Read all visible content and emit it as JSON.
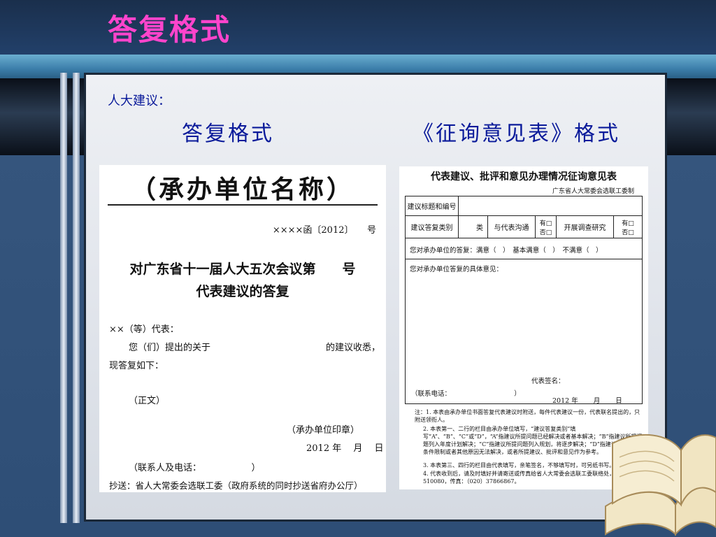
{
  "slide": {
    "title": "答复格式",
    "label": "人大建议：",
    "heading_left": "答复格式",
    "heading_right": "《征询意见表》格式"
  },
  "reply_doc": {
    "org_title": "（承办单位名称）",
    "ref_no": "××××函〔2012〕　　号",
    "heading_line1": "对广东省十一届人大五次会议第　　号",
    "heading_line2": "代表建议的答复",
    "salutation": "××（等）代表：",
    "body_line1_a": "您（们）提出的关于",
    "body_line1_b": "的建议收悉，",
    "body_line2": "现答复如下：",
    "main_text": "（正文）",
    "seal": "（承办单位印章）",
    "date": "2012 年　 月　 日",
    "contact": "（联系人及电话：　　　　　　）",
    "cc": "抄送：省人大常委会选联工委（政府系统的同时抄送省府办公厅）"
  },
  "survey_form": {
    "title": "代表建议、批评和意见办理情况征询意见表",
    "issuer": "广东省人大常委会选联工委制",
    "row1_label": "建议标题和编号",
    "row2_label": "建议答复类别",
    "row2_class": "类",
    "row2_contact": "与代表沟通",
    "row2_yes1": "有□",
    "row2_no1": "否□",
    "row2_survey": "开展调查研究",
    "row2_yes2": "有□",
    "row2_no2": "否□",
    "row3": "您对承办单位的答复：满意（　）　基本满意（　）　不满意（　）",
    "row4": "您对承办单位答复的具体意见：",
    "signature": "代表签名：",
    "phone": "（联系电话：　　　　　　　　　　）",
    "form_date": "2012 年　　 月　　 日",
    "note1": "注：1. 本表由承办单位书面答复代表建议时附送，每件代表建议一份，代表联名提出的，只附送领衔人。",
    "note2": "2. 本表第一、二行的栏目由承办单位填写，“建议答复类别”填写“A”、“B”、“C”或“D”，“A”指建议所提问题已经解决或者基本解决；“B”指建议所提问题列入年度计划解决；“C”指建议所提问题列入规划，将逐步解决；“D”指建议所提问题因条件限制或者其他原因无法解决，或者所提建议、批评和意见作为参考。",
    "note3": "3. 本表第三、四行的栏目由代表填写，亲笔签名，不够填写时，可另纸书写。",
    "note4": "4. 代表收到后，请及时填好并请寄送或传真给省人大常委会选联工委联络处，邮政编码：510080，传真：（020）37866867。"
  }
}
